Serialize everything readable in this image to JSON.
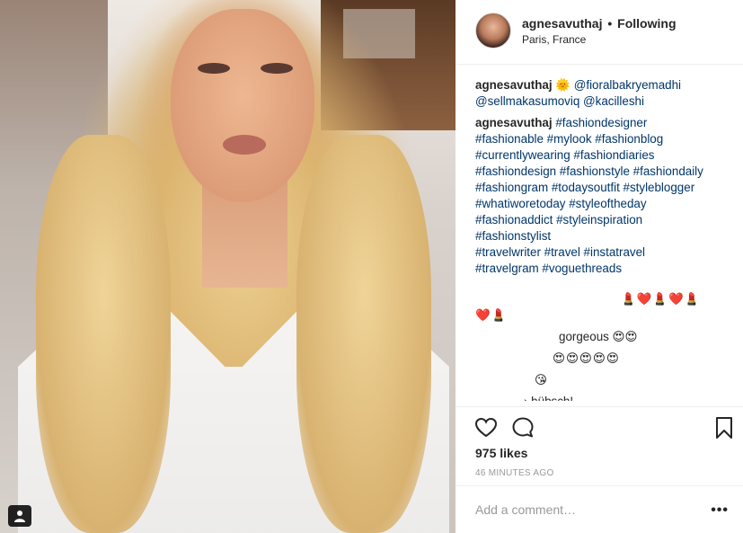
{
  "header": {
    "username": "agnesavuthaj",
    "separator": "•",
    "follow_state": "Following",
    "location": "Paris, France"
  },
  "mention_line": {
    "username": "agnesavuthaj",
    "emoji": "🌞",
    "mentions": [
      "@fioralbakryemadhi",
      "@sellmakasumoviq",
      "@kacilleshi"
    ]
  },
  "caption": {
    "username": "agnesavuthaj",
    "lines": [
      "#fashiondesigner",
      "#fashionable #mylook #fashionblog",
      "#currentlywearing #fashiondiaries",
      "#fashiondesign #fashionstyle #fashiondaily",
      "#fashiongram #todaysoutfit #styleblogger",
      "#whatiworetoday #styleoftheday",
      "#fashionaddict #styleinspiration",
      "#fashionstylist",
      "#travelwriter #travel #instatravel",
      "#travelgram #voguethreads"
    ]
  },
  "comments": [
    {
      "text": "💄❤️💄❤️💄"
    },
    {
      "text": "❤️💄"
    },
    {
      "text": "gorgeous 😍😍"
    },
    {
      "text": "😍😍😍😍😍"
    },
    {
      "text": "😘"
    },
    {
      "text": "› hübsch!"
    }
  ],
  "actions": {
    "like_icon": "heart-icon",
    "comment_icon": "comment-bubble-icon",
    "save_icon": "bookmark-icon"
  },
  "likes": "975 likes",
  "timestamp": "46 MINUTES AGO",
  "comment_input": {
    "placeholder": "Add a comment…"
  },
  "more_options": "•••"
}
